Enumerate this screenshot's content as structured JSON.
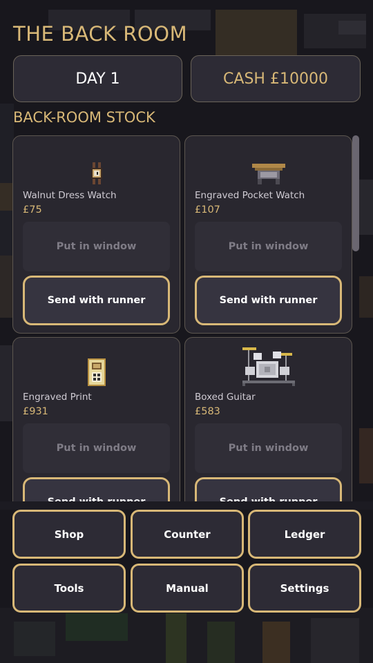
{
  "header": {
    "title": "THE BACK ROOM",
    "day": "DAY 1",
    "cash": "CASH £10000",
    "section_label": "BACK-ROOM STOCK"
  },
  "stock": [
    {
      "name": "Walnut Dress Watch",
      "price": "£75",
      "sprite": "dress-watch-sprite",
      "window_label": "Put in window",
      "runner_label": "Send with runner"
    },
    {
      "name": "Engraved Pocket Watch",
      "price": "£107",
      "sprite": "pocket-watch-sprite",
      "window_label": "Put in window",
      "runner_label": "Send with runner"
    },
    {
      "name": "Engraved Print",
      "price": "£931",
      "sprite": "print-sprite",
      "window_label": "Put in window",
      "runner_label": "Send with runner"
    },
    {
      "name": "Boxed Guitar",
      "price": "£583",
      "sprite": "drum-kit-sprite",
      "window_label": "Put in window",
      "runner_label": "Send with runner"
    }
  ],
  "nav": {
    "shop": "Shop",
    "counter": "Counter",
    "ledger": "Ledger",
    "tools": "Tools",
    "manual": "Manual",
    "settings": "Settings"
  },
  "colors": {
    "accent_gold": "#d8b877",
    "panel": "#2d2b35",
    "card": "#29272f",
    "background": "#1b1a20"
  }
}
